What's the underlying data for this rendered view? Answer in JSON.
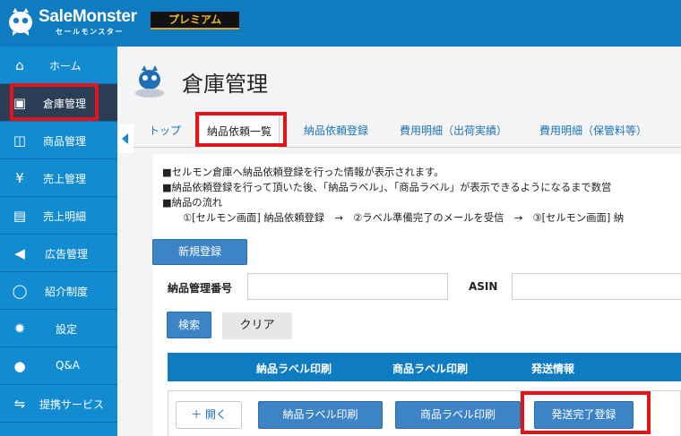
{
  "header": {
    "logo_title": "SaleMonster",
    "logo_subtitle": "セールモンスター",
    "plan_badge": "プレミアム"
  },
  "sidebar": {
    "items": [
      {
        "label": "ホーム",
        "icon": "home-icon",
        "glyph": "⌂"
      },
      {
        "label": "倉庫管理",
        "icon": "warehouse-icon",
        "glyph": "▣",
        "active": true
      },
      {
        "label": "商品管理",
        "icon": "gift-icon",
        "glyph": "◫"
      },
      {
        "label": "売上管理",
        "icon": "yen-icon",
        "glyph": "¥"
      },
      {
        "label": "売上明細",
        "icon": "document-icon",
        "glyph": "▤"
      },
      {
        "label": "広告管理",
        "icon": "megaphone-icon",
        "glyph": "◀"
      },
      {
        "label": "紹介制度",
        "icon": "chat-bubble-icon",
        "glyph": "◯"
      },
      {
        "label": "設定",
        "icon": "gear-icon",
        "glyph": "✹"
      },
      {
        "label": "Q&A",
        "icon": "comments-icon",
        "glyph": "●"
      },
      {
        "label": "提携サービス",
        "icon": "handshake-icon",
        "glyph": "⇋"
      }
    ]
  },
  "page": {
    "title": "倉庫管理"
  },
  "tabs": [
    "トップ",
    "納品依頼一覧",
    "納品依頼登録",
    "費用明細（出荷実績）",
    "費用明細（保管料等）"
  ],
  "notes": {
    "line1": "■セルモン倉庫へ納品依頼登録を行った情報が表示されます。",
    "line2": "■納品依頼登録を行って頂いた後、「納品ラベル」、「商品ラベル」が表示できるようになるまで数営",
    "line3": "■納品の流れ",
    "line4": "①[セルモン画面] 納品依頼登録　→　②ラベル準備完了のメールを受信　→　③[セルモン画面] 納"
  },
  "buttons": {
    "new": "新規登録",
    "search": "検索",
    "clear": "クリア",
    "open": "＋ 開く",
    "label_print": "納品ラベル印刷",
    "product_label_print": "商品ラベル印刷",
    "ship_complete": "発送完了登録"
  },
  "search": {
    "id_label": "納品管理番号",
    "asin_label": "ASIN",
    "id_value": "",
    "asin_value": ""
  },
  "table": {
    "headers": [
      "納品ラベル印刷",
      "商品ラベル印刷",
      "発送情報"
    ]
  },
  "colors": {
    "brand": "#0f7cc1",
    "sidebar": "#138bd0",
    "active": "#2c3e55",
    "highlight": "#e1141c",
    "badge": "#e8b82e"
  }
}
